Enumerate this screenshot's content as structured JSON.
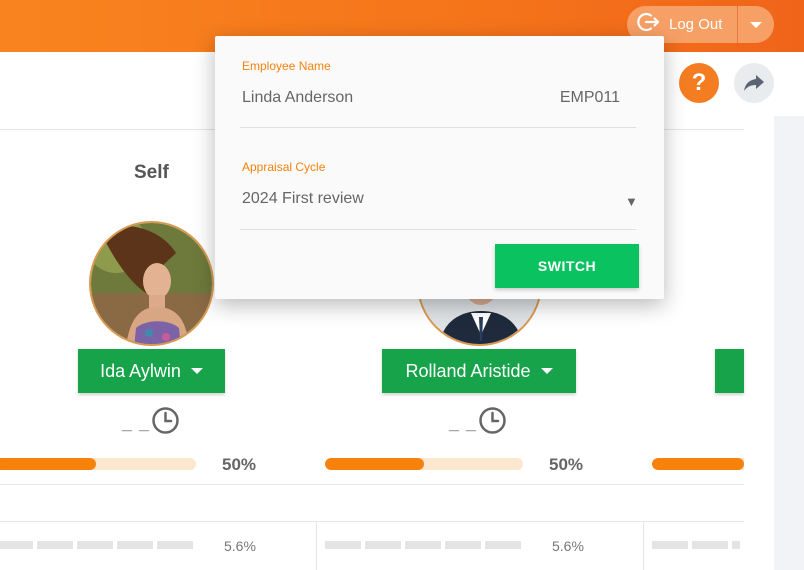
{
  "header": {
    "logout_label": "Log Out",
    "accent_color": "#f47d22"
  },
  "toolbar": {
    "help_symbol": "?"
  },
  "section": {
    "title": "Self"
  },
  "employees": [
    {
      "name": "Ida Aylwin",
      "time": "_ _",
      "progress_pct": 50,
      "progress_label": "50%",
      "weight": "5.6%"
    },
    {
      "name": "Rolland Aristide",
      "time": "_ _",
      "progress_pct": 50,
      "progress_label": "50%",
      "weight": "5.6%"
    }
  ],
  "modal": {
    "employee_label": "Employee Name",
    "employee_name": "Linda Anderson",
    "employee_code": "EMP011",
    "cycle_label": "Appraisal Cycle",
    "cycle_value": "2024 First review",
    "switch_label": "SWITCH"
  }
}
